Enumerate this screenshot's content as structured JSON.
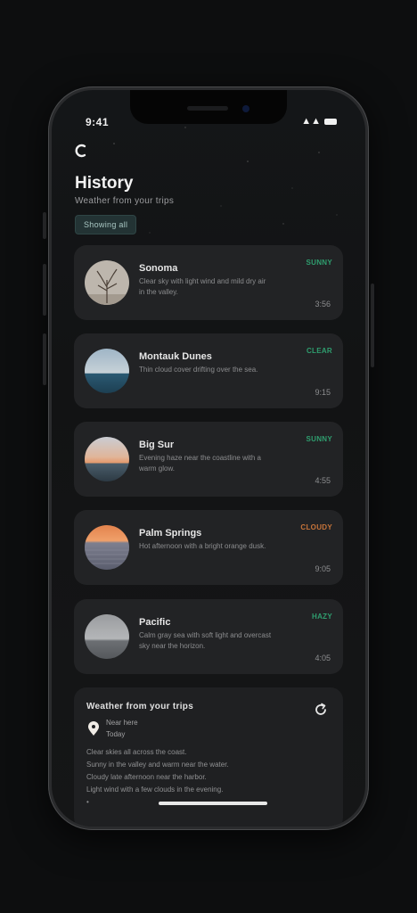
{
  "status_bar": {
    "time": "9:41",
    "signal": "▲▲"
  },
  "header": {
    "title": "History",
    "subtitle": "Weather from your trips",
    "filter_chip": "Showing all"
  },
  "cards": [
    {
      "title": "Sonoma",
      "desc": "Clear sky with light wind and mild dry air in the valley.",
      "tag": "SUNNY",
      "time": "3:56",
      "tag_color": "#2f9e6f"
    },
    {
      "title": "Montauk Dunes",
      "desc": "Thin cloud cover drifting over the sea.",
      "tag": "CLEAR",
      "time": "9:15",
      "tag_color": "#2f9e6f"
    },
    {
      "title": "Big Sur",
      "desc": "Evening haze near the coastline with a warm glow.",
      "tag": "SUNNY",
      "time": "4:55",
      "tag_color": "#2f9e6f"
    },
    {
      "title": "Palm Springs",
      "desc": "Hot afternoon with a bright orange dusk.",
      "tag": "CLOUDY",
      "time": "9:05",
      "tag_color": "#c7743a"
    },
    {
      "title": "Pacific",
      "desc": "Calm gray sea with soft light and overcast sky near the horizon.",
      "tag": "HAZY",
      "time": "4:05",
      "tag_color": "#2f9e6f"
    }
  ],
  "weather_card": {
    "title": "Weather from your trips",
    "location_line1": "Near here",
    "location_line2": "Today",
    "lines": [
      "Clear skies all across the coast.",
      "Sunny in the valley and warm near the water.",
      "Cloudy late afternoon near the harbor.",
      "Light wind with a few clouds in the evening."
    ],
    "footer": "•"
  },
  "colors": {
    "accent_green": "#2f9e6f",
    "accent_orange": "#c7743a",
    "card_bg": "#222325"
  },
  "icons": {
    "back": "back-chevron-icon",
    "refresh": "refresh-icon",
    "pin": "location-pin-icon"
  }
}
